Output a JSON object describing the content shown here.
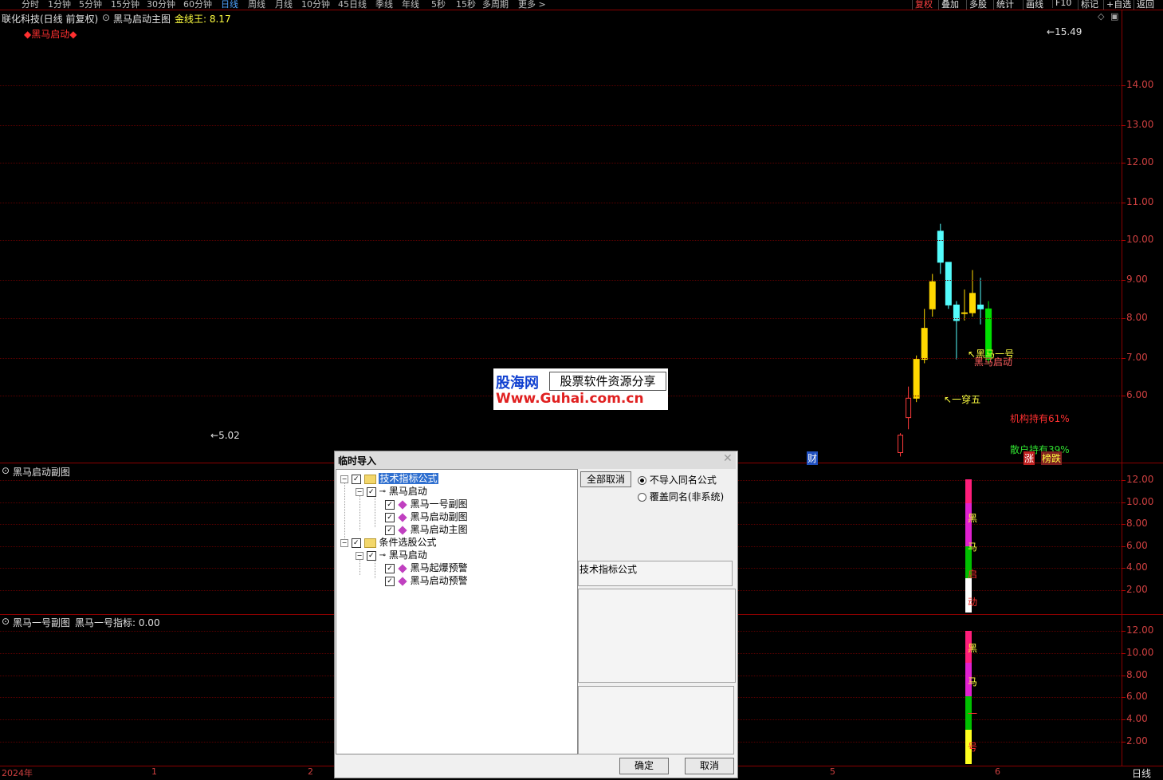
{
  "toolbar": {
    "periods": [
      "分时",
      "1分钟",
      "5分钟",
      "15分钟",
      "30分钟",
      "60分钟",
      "日线",
      "周线",
      "月线",
      "10分钟",
      "45日线",
      "季线",
      "年线",
      "5秒",
      "15秒",
      "多周期",
      "更多 >"
    ],
    "active_period": "日线",
    "right_buttons": [
      "复权",
      "叠加",
      "多股",
      "统计",
      "画线",
      "F10",
      "标记",
      "+自选",
      "返回"
    ]
  },
  "main_panel": {
    "stock_title": "联化科技(日线 前复权)",
    "formula_name": "黑马启动主图",
    "indicator_label": "金线王: 8.17",
    "indicator_name": "◆黑马启动◆",
    "y_ticks": [
      "14.00",
      "13.00",
      "12.00",
      "11.00",
      "10.00",
      "9.00",
      "8.00",
      "7.00",
      "6.00"
    ],
    "annotations": {
      "high_price": "15.49",
      "low_price": "5.02",
      "yi_chuan_wu": "一穿五",
      "hei_ma_label": "黑马一号",
      "hei_ma_start": "黑马启动",
      "institution": "机构持有61%",
      "retail": "散户持有39%",
      "cai_marker": "财",
      "zhang_marker": "涨",
      "bang_marker": "榜跌"
    },
    "colors": {
      "up": "#ff3b3b",
      "down": "#54fcfc",
      "gold_line": "#ffff40",
      "boost": "#ffd800",
      "green": "#00e000"
    }
  },
  "sub_panel_1": {
    "title": "黑马启动副图",
    "y_ticks": [
      "12.00",
      "10.00",
      "8.00",
      "6.00",
      "4.00",
      "2.00"
    ],
    "bar_chars": [
      "黑",
      "马",
      "启",
      "动"
    ]
  },
  "sub_panel_2": {
    "title": "黑马一号副图",
    "indicator_label": "黑马一号指标: 0.00",
    "y_ticks": [
      "12.00",
      "10.00",
      "8.00",
      "6.00",
      "4.00",
      "2.00"
    ],
    "bar_chars": [
      "黑",
      "马",
      "一",
      "号"
    ]
  },
  "time_axis": {
    "labels": [
      "2024年",
      "1",
      "2",
      "5",
      "6"
    ],
    "period_label": "日线"
  },
  "ad": {
    "logo_text": "股海网",
    "slogan": "股票软件资源分享",
    "url": "Www.Guhai.com.cn"
  },
  "dialog": {
    "title": "临时导入",
    "tree": [
      {
        "label": "技术指标公式",
        "level": 0,
        "selected": true
      },
      {
        "label": "黑马启动",
        "level": 1
      },
      {
        "label": "黑马一号副图",
        "level": 2
      },
      {
        "label": "黑马启动副图",
        "level": 2
      },
      {
        "label": "黑马启动主图",
        "level": 2
      },
      {
        "label": "条件选股公式",
        "level": 0
      },
      {
        "label": "黑马启动",
        "level": 1
      },
      {
        "label": "黑马起爆预警",
        "level": 2
      },
      {
        "label": "黑马启动预警",
        "level": 2
      }
    ],
    "deselect_all": "全部取消",
    "option_skip": "不导入同名公式",
    "option_overwrite": "覆盖同名(非系统)",
    "category_label": "技术指标公式",
    "ok": "确定",
    "cancel": "取消"
  }
}
